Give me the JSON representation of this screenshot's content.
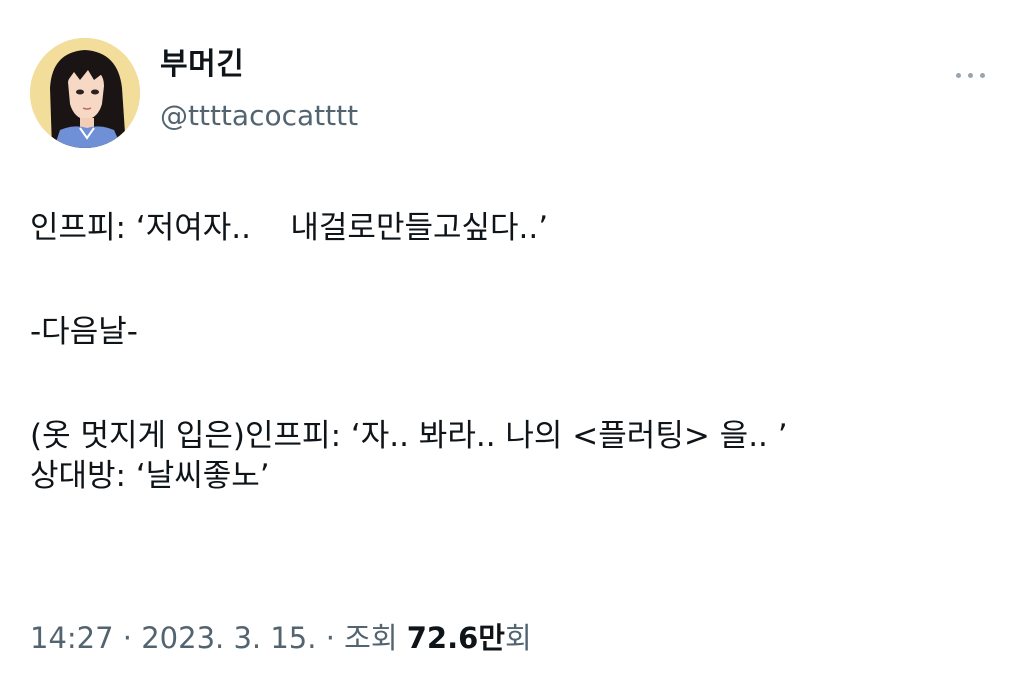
{
  "author": {
    "display_name": "부머긴",
    "handle": "@ttttacocatttt",
    "avatar_icon": "anime-girl-avatar"
  },
  "more_icon": "more-horizontal-icon",
  "tweet": {
    "lines": [
      "인프피: ‘저여자..    내걸로만들고싶다..’",
      "-다음날-",
      "(옷 멋지게 입은)인프피: ‘자.. 봐라.. 나의 <플러팅> 을.. ’",
      "상대방: ‘날씨좋노’"
    ]
  },
  "meta": {
    "time": "14:27",
    "separator": " · ",
    "date": "2023. 3. 15.",
    "views_label": "조회",
    "views_count": "72.6만",
    "views_suffix": "회"
  },
  "colors": {
    "text": "#0f1419",
    "secondary": "#536471",
    "avatar_bg": "#f2dd9a"
  }
}
